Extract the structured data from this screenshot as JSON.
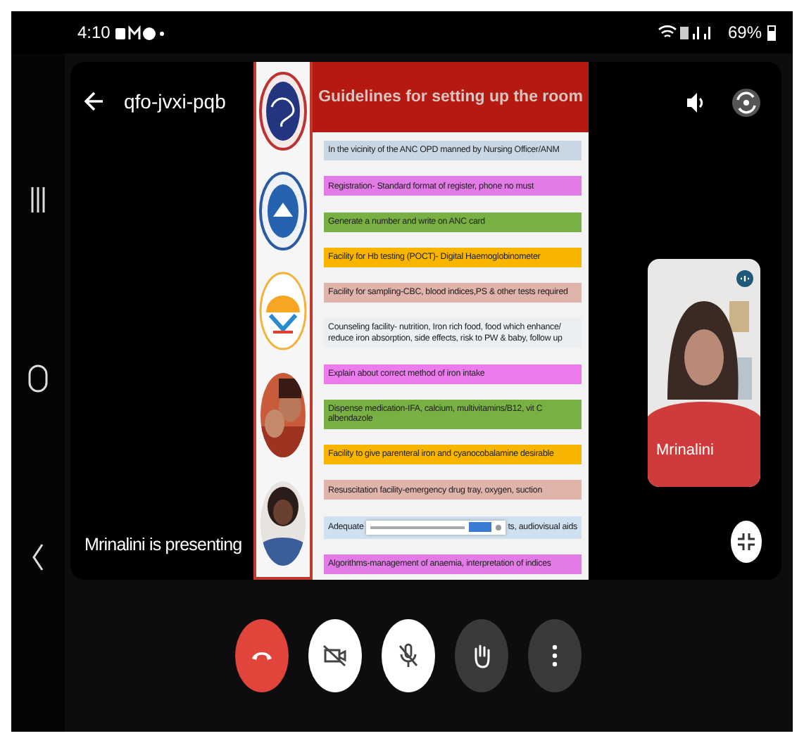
{
  "status_bar": {
    "time": "4:10",
    "battery": "69%"
  },
  "meeting": {
    "code": "qfo-jvxi-pqb",
    "presenting": "Mrinalini is presenting"
  },
  "slide": {
    "title": "Guidelines for setting up the room",
    "rows": [
      {
        "text": "In the vicinity of the ANC OPD manned by Nursing Officer/ANM",
        "color": "#c9d7e4"
      },
      {
        "text": "Registration- Standard format of register, phone no must",
        "color": "#e27be6"
      },
      {
        "text": "Generate a number and write on ANC card",
        "color": "#79b043"
      },
      {
        "text": "Facility for Hb testing (POCT)- Digital Haemoglobinometer",
        "color": "#f7b500"
      },
      {
        "text": "Facility for sampling-CBC, blood indices,PS & other tests required",
        "color": "#e0b3ab"
      },
      {
        "text": "Counseling facility- nutrition, Iron rich food, food which enhance/ reduce iron absorption, side effects, risk to PW & baby, follow up",
        "color": "#eceff2"
      },
      {
        "text": "Explain about correct method of iron intake",
        "color": "#ec7cee"
      },
      {
        "text": "Dispense medication-IFA, calcium, multivitamins/B12, vit C albendazole",
        "color": "#79b043"
      },
      {
        "text": "Facility to give parenteral iron and cyanocobalamine desirable",
        "color": "#f7b500"
      },
      {
        "text": "Resuscitation facility-emergency drug tray, oxygen, suction",
        "color": "#e0b3ab"
      },
      {
        "text": "Adequate",
        "text_after": "ts, audiovisual aids",
        "covered": true,
        "color": "#cfe0f0"
      },
      {
        "text": "Algorithms-management of anaemia, interpretation of indices",
        "color": "#e27be6"
      }
    ]
  },
  "participant": {
    "name": "Mrinalini"
  },
  "controls": [
    {
      "kind": "end-call"
    },
    {
      "kind": "camera-off"
    },
    {
      "kind": "mic-off"
    },
    {
      "kind": "raise-hand"
    },
    {
      "kind": "more"
    }
  ]
}
